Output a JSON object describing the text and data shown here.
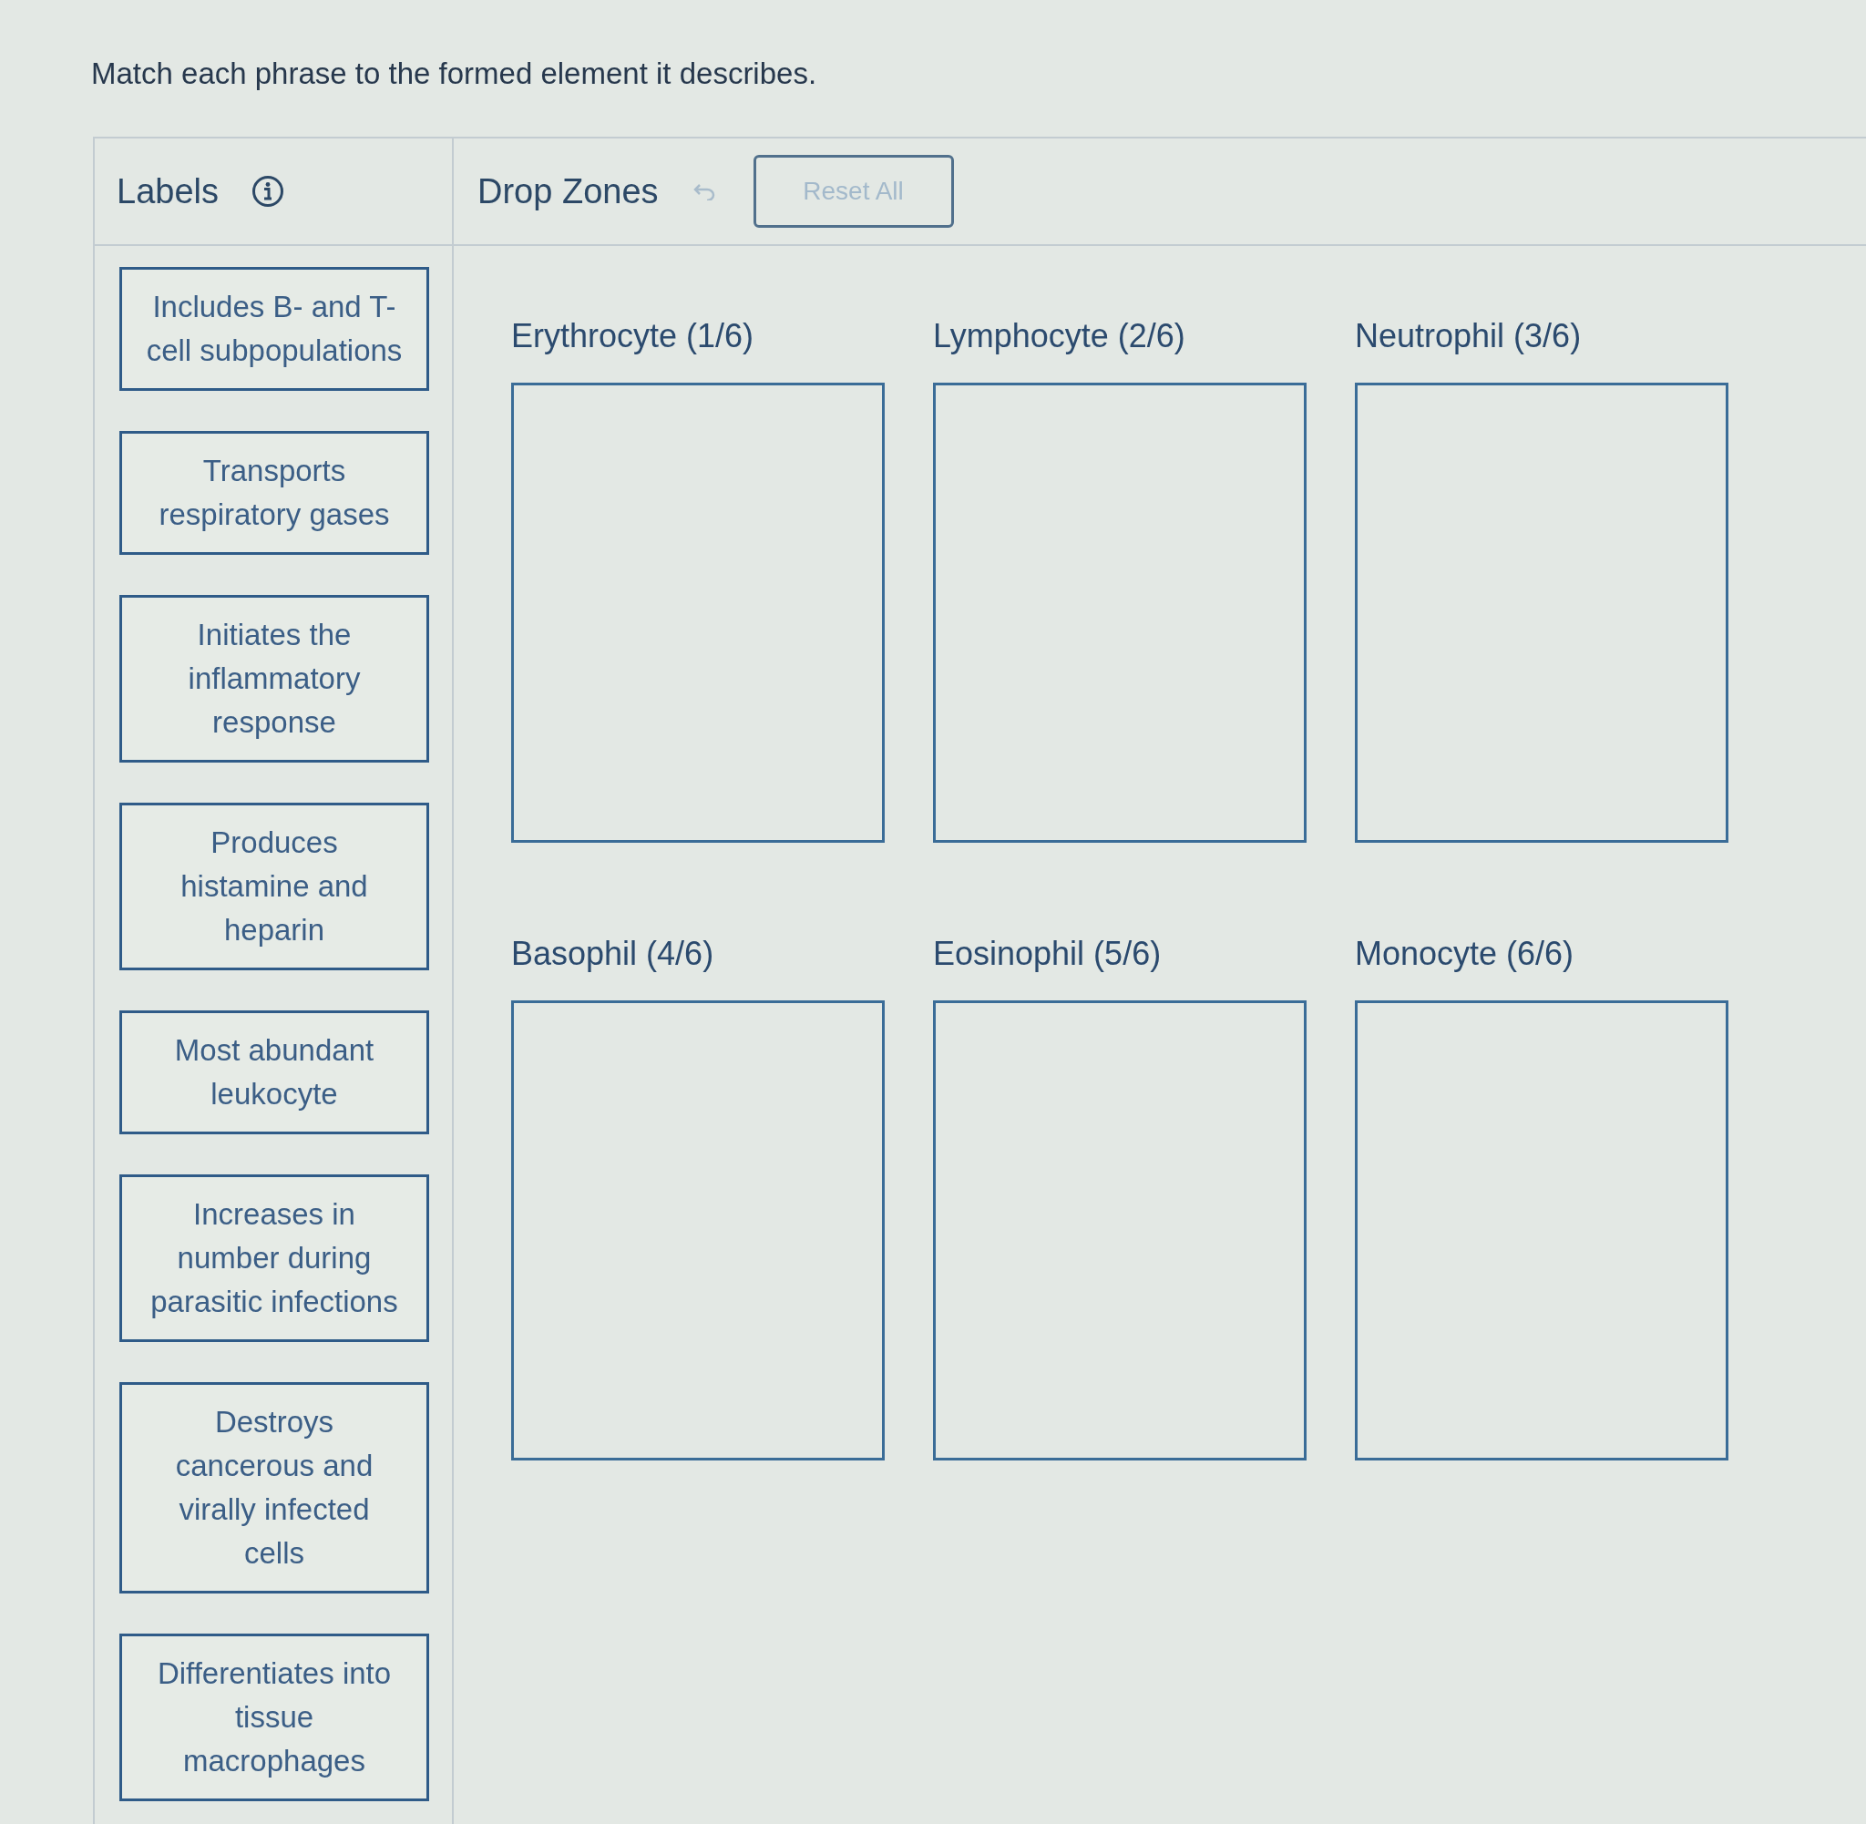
{
  "instruction": "Match each phrase to the formed element it describes.",
  "labels_panel": {
    "title": "Labels",
    "labels": [
      "Includes B- and T-cell subpopulations",
      "Transports respiratory gases",
      "Initiates the inflammatory response",
      "Produces histamine and heparin",
      "Most abundant leukocyte",
      "Increases in number during parasitic infections",
      "Destroys cancerous and virally infected cells",
      "Differentiates into tissue macrophages"
    ]
  },
  "drop_zones_panel": {
    "title": "Drop Zones",
    "undo_button": {
      "disabled": true
    },
    "reset_button": {
      "label": "Reset All",
      "disabled": true
    },
    "zones": [
      {
        "title": "Erythrocyte (1/6)"
      },
      {
        "title": "Lymphocyte (2/6)"
      },
      {
        "title": "Neutrophil (3/6)"
      },
      {
        "title": "Basophil (4/6)"
      },
      {
        "title": "Eosinophil (5/6)"
      },
      {
        "title": "Monocyte (6/6)"
      }
    ]
  }
}
